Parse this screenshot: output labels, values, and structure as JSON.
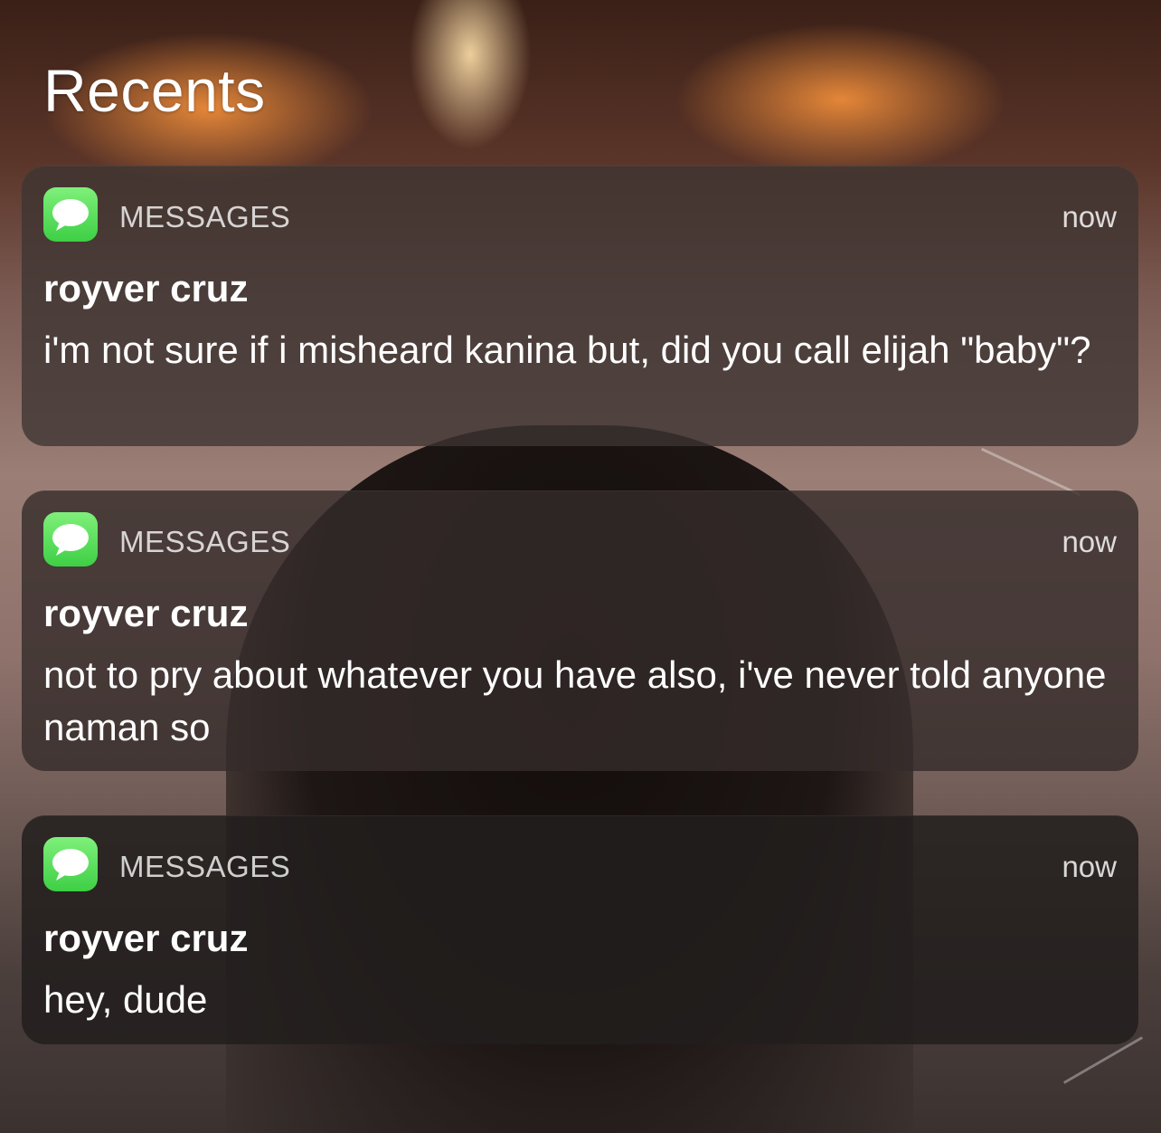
{
  "header": {
    "title": "Recents"
  },
  "notifications": [
    {
      "app": "MESSAGES",
      "time": "now",
      "sender": "royver cruz",
      "message": "i'm not sure if i misheard kanina but, did you call elijah \"baby\"?"
    },
    {
      "app": "MESSAGES",
      "time": "now",
      "sender": "royver cruz",
      "message": "not to pry about whatever you have also, i've never told anyone naman so"
    },
    {
      "app": "MESSAGES",
      "time": "now",
      "sender": "royver cruz",
      "message": "hey, dude"
    }
  ],
  "icons": {
    "app_icon": "messages-icon"
  },
  "colors": {
    "messages_green": "#3ecf45",
    "text": "#ffffff"
  }
}
